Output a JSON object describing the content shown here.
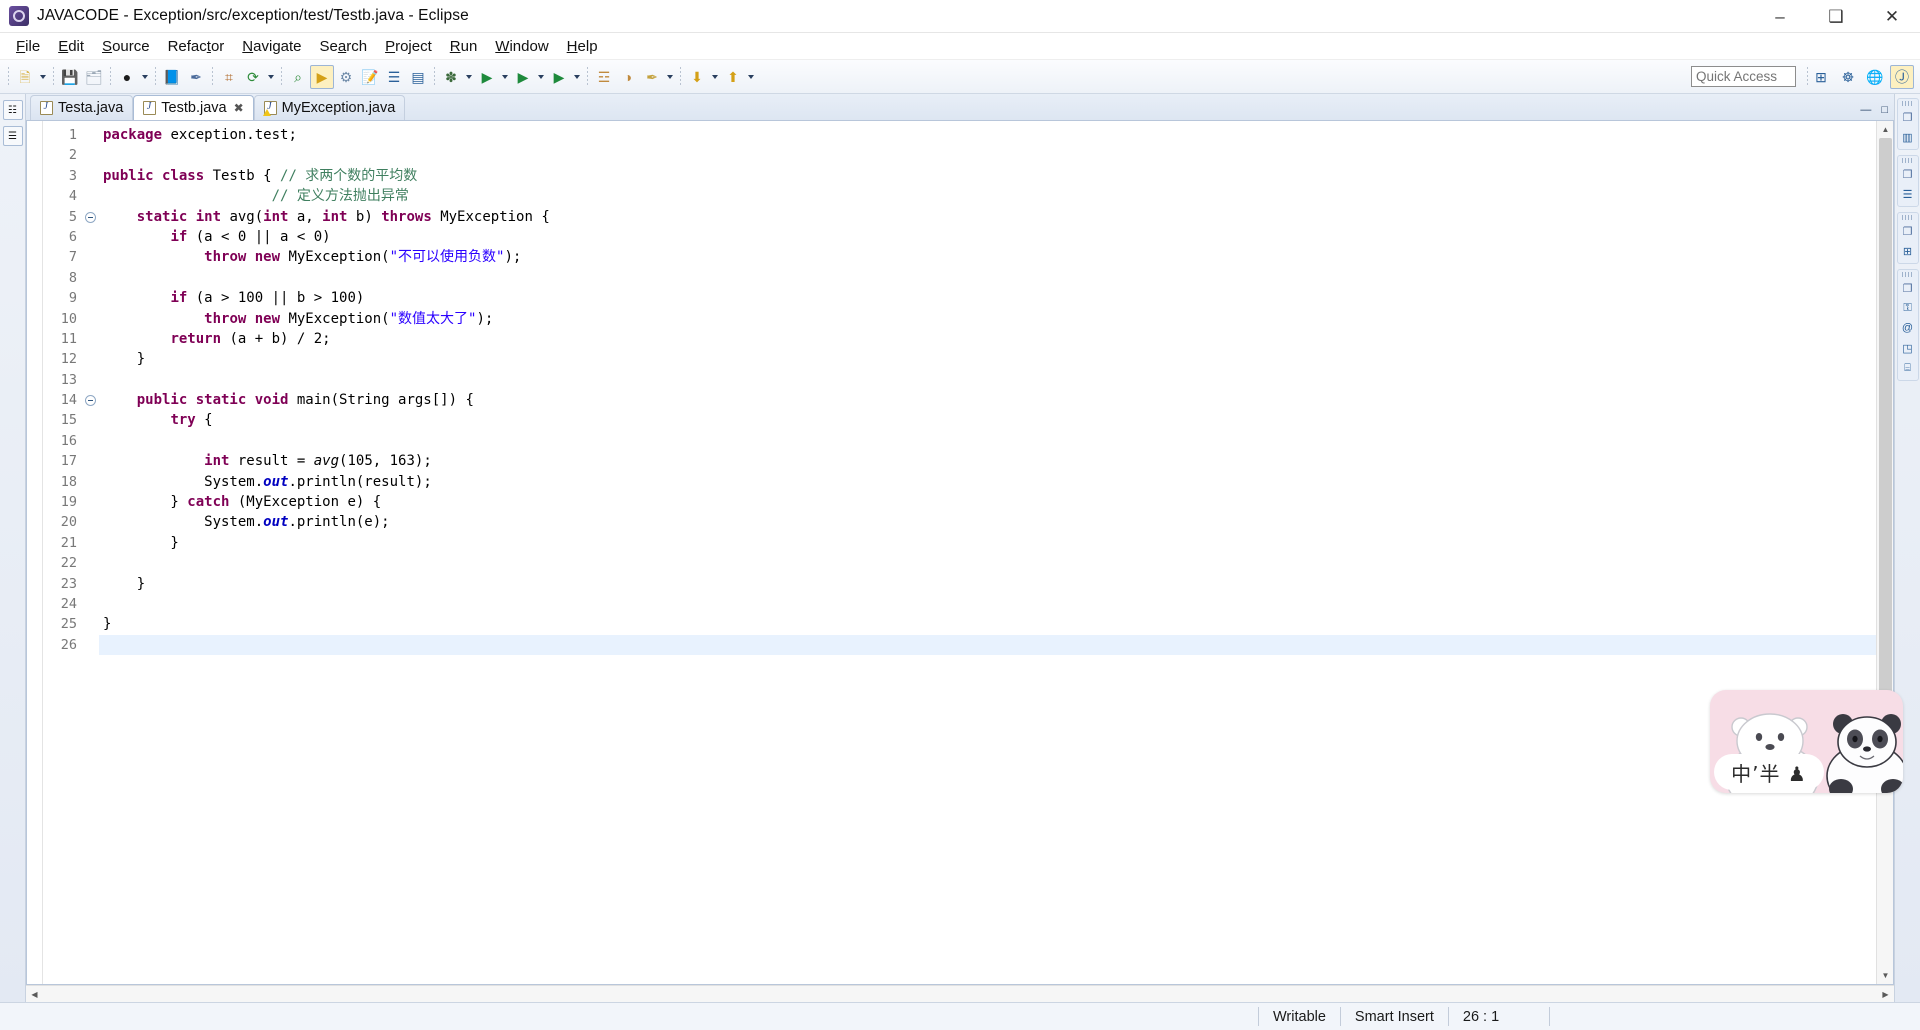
{
  "window": {
    "title": "JAVACODE - Exception/src/exception/test/Testb.java - Eclipse",
    "app_icon": "eclipse-icon",
    "minimize": "–",
    "maximize": "❑",
    "close": "✕"
  },
  "menubar": [
    {
      "label": "File",
      "mnemonic": "F"
    },
    {
      "label": "Edit",
      "mnemonic": "E"
    },
    {
      "label": "Source",
      "mnemonic": "S"
    },
    {
      "label": "Refactor",
      "mnemonic": "t"
    },
    {
      "label": "Navigate",
      "mnemonic": "N"
    },
    {
      "label": "Search",
      "mnemonic": "a"
    },
    {
      "label": "Project",
      "mnemonic": "P"
    },
    {
      "label": "Run",
      "mnemonic": "R"
    },
    {
      "label": "Window",
      "mnemonic": "W"
    },
    {
      "label": "Help",
      "mnemonic": "H"
    }
  ],
  "toolbar": {
    "quick_access_placeholder": "Quick Access",
    "quick_access_value": "",
    "buttons": [
      {
        "name": "new-wizard",
        "glyph": "🗎",
        "color": "#d9b44a",
        "dropdown": true
      },
      {
        "name": "save",
        "glyph": "💾",
        "color": "#9aa7b5",
        "dropdown": false
      },
      {
        "name": "save-all",
        "glyph": "🗂",
        "color": "#9aa7b5",
        "dropdown": false
      },
      {
        "name": "print",
        "glyph": "●",
        "color": "#1c1c1c",
        "dropdown": true
      },
      {
        "name": "new-java-package",
        "glyph": "📘",
        "color": "#2a6099",
        "dropdown": false
      },
      {
        "name": "link-editor",
        "glyph": "✒",
        "color": "#4a6a9a",
        "dropdown": false
      },
      {
        "name": "new-class",
        "glyph": "⌗",
        "color": "#b06a2a",
        "dropdown": false
      },
      {
        "name": "refresh",
        "glyph": "⟳",
        "color": "#2e8b3a",
        "dropdown": true
      },
      {
        "name": "search",
        "glyph": "⌕",
        "color": "#2e8b3a",
        "dropdown": false
      },
      {
        "name": "run-as",
        "glyph": "▶",
        "color": "#d4a017",
        "selected": true,
        "dropdown": false
      },
      {
        "name": "external-tools",
        "glyph": "⚙",
        "color": "#6e8aa8",
        "dropdown": false
      },
      {
        "name": "open-task",
        "glyph": "📝",
        "color": "#4a6a9a",
        "dropdown": false
      },
      {
        "name": "toggle-markers",
        "glyph": "☰",
        "color": "#2a6099",
        "dropdown": false
      },
      {
        "name": "toggle-breadcrumb",
        "glyph": "▤",
        "color": "#2a6099",
        "dropdown": false
      },
      {
        "name": "debug",
        "glyph": "✽",
        "color": "#3c6a3c",
        "dropdown": true
      },
      {
        "name": "run",
        "glyph": "▶",
        "color": "#1e8a3c",
        "dropdown": true
      },
      {
        "name": "coverage",
        "glyph": "▶",
        "color": "#1e8a3c",
        "dropdown": true
      },
      {
        "name": "run-last",
        "glyph": "▶",
        "color": "#1e8a3c",
        "dropdown": true
      },
      {
        "name": "new-java-project",
        "glyph": "☲",
        "color": "#c08a3e",
        "dropdown": false
      },
      {
        "name": "open-type",
        "glyph": "◑",
        "color": "#c08a3e",
        "dropdown": false
      },
      {
        "name": "quick-fix",
        "glyph": "✒",
        "color": "#c4a23e",
        "dropdown": true
      },
      {
        "name": "next-annotation",
        "glyph": "⬇",
        "color": "#d4a017",
        "dropdown": true
      },
      {
        "name": "previous-annotation",
        "glyph": "⬆",
        "color": "#d4a017",
        "dropdown": true
      }
    ],
    "perspective_buttons": [
      {
        "name": "open-perspective",
        "glyph": "⊞"
      },
      {
        "name": "java-ee-perspective",
        "glyph": "☸"
      },
      {
        "name": "web-perspective",
        "glyph": "🌐"
      },
      {
        "name": "java-perspective",
        "glyph": "Ⓙ"
      }
    ]
  },
  "tabs": [
    {
      "label": "Testa.java",
      "active": false,
      "dirty": false,
      "warning": false
    },
    {
      "label": "Testb.java",
      "active": true,
      "dirty": false,
      "warning": false,
      "close": "✖"
    },
    {
      "label": "MyException.java",
      "active": false,
      "dirty": false,
      "warning": true
    }
  ],
  "editor": {
    "minimize_glyph": "—",
    "maximize_glyph": "□",
    "current_line": 26,
    "lines": [
      {
        "n": 1,
        "fold": false,
        "method_bar": false,
        "tokens": [
          {
            "t": "package ",
            "c": "kw"
          },
          {
            "t": "exception.test;",
            "c": ""
          }
        ]
      },
      {
        "n": 2,
        "fold": false,
        "method_bar": false,
        "tokens": []
      },
      {
        "n": 3,
        "fold": false,
        "method_bar": false,
        "tokens": [
          {
            "t": "public class ",
            "c": "kw"
          },
          {
            "t": "Testb { ",
            "c": ""
          },
          {
            "t": "// 求两个数的平均数",
            "c": "cm"
          }
        ]
      },
      {
        "n": 4,
        "fold": false,
        "method_bar": false,
        "tokens": [
          {
            "t": "                    // 定义方法抛出异常",
            "c": "cm"
          }
        ]
      },
      {
        "n": 5,
        "fold": true,
        "method_bar": false,
        "tokens": [
          {
            "t": "    ",
            "c": ""
          },
          {
            "t": "static int ",
            "c": "kw"
          },
          {
            "t": "avg(",
            "c": ""
          },
          {
            "t": "int ",
            "c": "kw"
          },
          {
            "t": "a, ",
            "c": ""
          },
          {
            "t": "int ",
            "c": "kw"
          },
          {
            "t": "b) ",
            "c": ""
          },
          {
            "t": "throws ",
            "c": "kw"
          },
          {
            "t": "MyException {",
            "c": ""
          }
        ]
      },
      {
        "n": 6,
        "fold": false,
        "method_bar": false,
        "tokens": [
          {
            "t": "        ",
            "c": ""
          },
          {
            "t": "if ",
            "c": "kw"
          },
          {
            "t": "(a < 0 || a < 0)",
            "c": ""
          }
        ]
      },
      {
        "n": 7,
        "fold": false,
        "method_bar": false,
        "tokens": [
          {
            "t": "            ",
            "c": ""
          },
          {
            "t": "throw new ",
            "c": "kw"
          },
          {
            "t": "MyException(",
            "c": ""
          },
          {
            "t": "\"不可以使用负数\"",
            "c": "st"
          },
          {
            "t": ");",
            "c": ""
          }
        ]
      },
      {
        "n": 8,
        "fold": false,
        "method_bar": false,
        "tokens": []
      },
      {
        "n": 9,
        "fold": false,
        "method_bar": false,
        "tokens": [
          {
            "t": "        ",
            "c": ""
          },
          {
            "t": "if ",
            "c": "kw"
          },
          {
            "t": "(a > 100 || b > 100)",
            "c": ""
          }
        ]
      },
      {
        "n": 10,
        "fold": false,
        "method_bar": false,
        "tokens": [
          {
            "t": "            ",
            "c": ""
          },
          {
            "t": "throw new ",
            "c": "kw"
          },
          {
            "t": "MyException(",
            "c": ""
          },
          {
            "t": "\"数值太大了\"",
            "c": "st"
          },
          {
            "t": ");",
            "c": ""
          }
        ]
      },
      {
        "n": 11,
        "fold": false,
        "method_bar": false,
        "tokens": [
          {
            "t": "        ",
            "c": ""
          },
          {
            "t": "return ",
            "c": "kw"
          },
          {
            "t": "(a + b) / 2;",
            "c": ""
          }
        ]
      },
      {
        "n": 12,
        "fold": false,
        "method_bar": false,
        "tokens": [
          {
            "t": "    }",
            "c": ""
          }
        ]
      },
      {
        "n": 13,
        "fold": false,
        "method_bar": false,
        "tokens": []
      },
      {
        "n": 14,
        "fold": true,
        "method_bar": true,
        "tokens": [
          {
            "t": "    ",
            "c": ""
          },
          {
            "t": "public static void ",
            "c": "kw"
          },
          {
            "t": "main(String args[]) {",
            "c": ""
          }
        ]
      },
      {
        "n": 15,
        "fold": false,
        "method_bar": true,
        "tokens": [
          {
            "t": "        ",
            "c": ""
          },
          {
            "t": "try ",
            "c": "kw"
          },
          {
            "t": "{",
            "c": ""
          }
        ]
      },
      {
        "n": 16,
        "fold": false,
        "method_bar": true,
        "tokens": []
      },
      {
        "n": 17,
        "fold": false,
        "method_bar": true,
        "tokens": [
          {
            "t": "            ",
            "c": ""
          },
          {
            "t": "int ",
            "c": "kw"
          },
          {
            "t": "result = ",
            "c": ""
          },
          {
            "t": "avg",
            "c": "stm"
          },
          {
            "t": "(105, 163);",
            "c": ""
          }
        ]
      },
      {
        "n": 18,
        "fold": false,
        "method_bar": true,
        "tokens": [
          {
            "t": "            System.",
            "c": ""
          },
          {
            "t": "out",
            "c": "fld"
          },
          {
            "t": ".println(result);",
            "c": ""
          }
        ]
      },
      {
        "n": 19,
        "fold": false,
        "method_bar": true,
        "tokens": [
          {
            "t": "        } ",
            "c": ""
          },
          {
            "t": "catch ",
            "c": "kw"
          },
          {
            "t": "(MyException e) {",
            "c": ""
          }
        ]
      },
      {
        "n": 20,
        "fold": false,
        "method_bar": true,
        "tokens": [
          {
            "t": "            System.",
            "c": ""
          },
          {
            "t": "out",
            "c": "fld"
          },
          {
            "t": ".println(e);",
            "c": ""
          }
        ]
      },
      {
        "n": 21,
        "fold": false,
        "method_bar": true,
        "tokens": [
          {
            "t": "        }",
            "c": ""
          }
        ]
      },
      {
        "n": 22,
        "fold": false,
        "method_bar": true,
        "tokens": []
      },
      {
        "n": 23,
        "fold": false,
        "method_bar": true,
        "tokens": [
          {
            "t": "    }",
            "c": ""
          }
        ]
      },
      {
        "n": 24,
        "fold": false,
        "method_bar": false,
        "tokens": []
      },
      {
        "n": 25,
        "fold": false,
        "method_bar": false,
        "tokens": [
          {
            "t": "}",
            "c": ""
          }
        ]
      },
      {
        "n": 26,
        "fold": false,
        "method_bar": false,
        "tokens": []
      }
    ]
  },
  "left_rail": [
    {
      "name": "package-explorer-view",
      "glyph": "☷"
    },
    {
      "name": "outline-view",
      "glyph": "☰"
    }
  ],
  "right_rail": [
    {
      "name": "restore-group-1",
      "icons": [
        "❐",
        "▥"
      ]
    },
    {
      "name": "restore-group-2",
      "icons": [
        "❐",
        "☰"
      ]
    },
    {
      "name": "restore-group-3",
      "icons": [
        "❐",
        "⊞"
      ]
    },
    {
      "name": "restore-group-4",
      "icons": [
        "❐",
        "⚿",
        "@",
        "◳",
        "⌸"
      ]
    }
  ],
  "statusbar": {
    "writable": "Writable",
    "insert_mode": "Smart Insert",
    "position": "26 : 1"
  },
  "scrollbars": {
    "v_up": "▲",
    "v_down": "▼",
    "h_left": "◀",
    "h_right": "▶"
  },
  "sticker": {
    "name": "we-bare-bears-sticker",
    "bubble_text": "中’半 ♟",
    "background": "#f7dde6"
  },
  "colors": {
    "keyword": "#7f0055",
    "comment": "#3f7f5f",
    "string": "#2a00ff",
    "field": "#0000c0",
    "current_line": "#e8f2fe",
    "method_bar": "#b8cfe8"
  }
}
